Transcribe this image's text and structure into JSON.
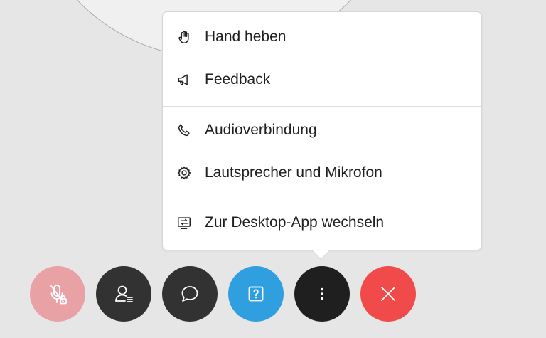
{
  "menu": {
    "items": [
      {
        "label": "Hand heben",
        "icon": "raise-hand-icon"
      },
      {
        "label": "Feedback",
        "icon": "megaphone-icon"
      },
      {
        "label": "Audioverbindung",
        "icon": "phone-icon"
      },
      {
        "label": "Lautsprecher und Mikrofon",
        "icon": "gear-icon"
      },
      {
        "label": "Zur Desktop-App wechseln",
        "icon": "desktop-switch-icon"
      }
    ]
  },
  "controls": [
    {
      "name": "mute",
      "icon": "microphone-muted-locked-icon",
      "color": "#e8a1a5"
    },
    {
      "name": "participants",
      "icon": "participants-icon",
      "color": "#323232"
    },
    {
      "name": "chat",
      "icon": "chat-bubble-icon",
      "color": "#323232"
    },
    {
      "name": "qa",
      "icon": "question-mark-icon",
      "color": "#2f9fe0"
    },
    {
      "name": "more",
      "icon": "more-vertical-icon",
      "color": "#1f1f1f"
    },
    {
      "name": "leave",
      "icon": "close-icon",
      "color": "#f04a4a"
    }
  ]
}
